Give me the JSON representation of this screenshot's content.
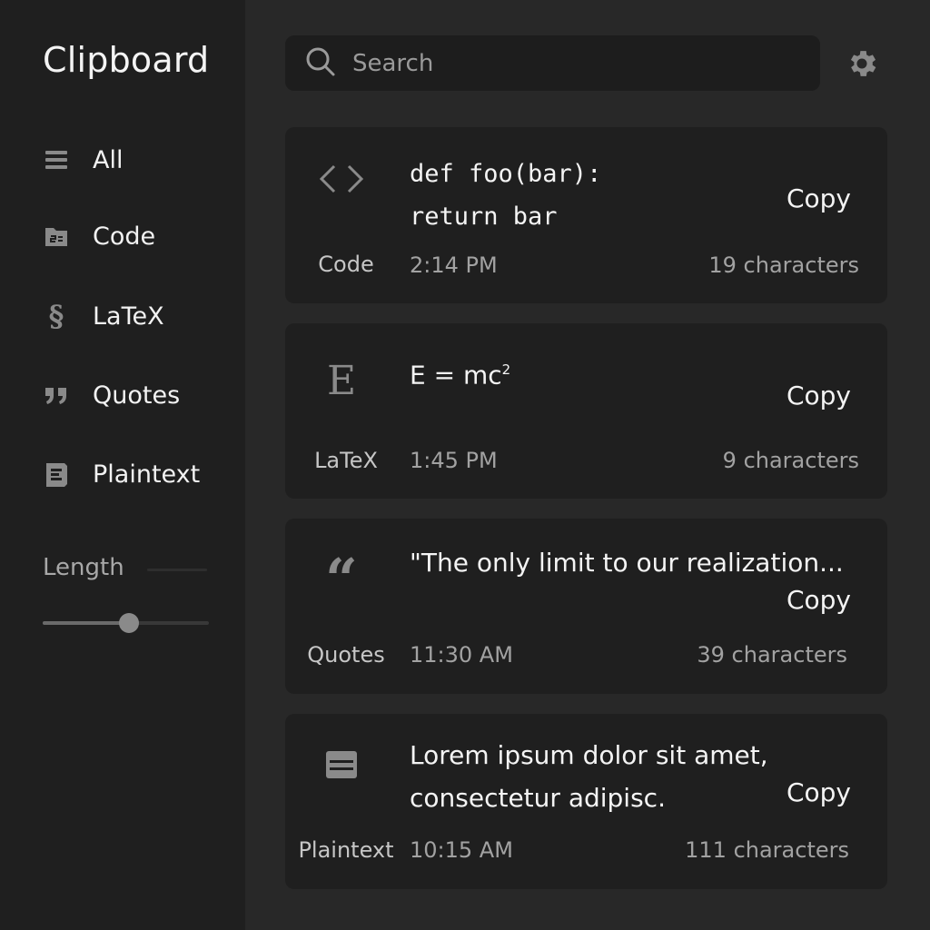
{
  "app": {
    "title": "Clipboard"
  },
  "sidebar": {
    "items": [
      {
        "label": "All",
        "icon": "list-icon"
      },
      {
        "label": "Code",
        "icon": "code-folder-icon"
      },
      {
        "label": "LaTeX",
        "icon": "section-icon"
      },
      {
        "label": "Quotes",
        "icon": "quote-icon"
      },
      {
        "label": "Plaintext",
        "icon": "text-icon"
      }
    ],
    "filter": {
      "label": "Length",
      "value_fraction": 0.52
    }
  },
  "search": {
    "placeholder": "Search",
    "value": ""
  },
  "clips": [
    {
      "type": "Code",
      "icon": "code-brackets-icon",
      "content_line1": "def foo(bar):",
      "content_line2": "return bar",
      "copy_label": "Copy",
      "time": "2:14 PM",
      "chars": "19 characters"
    },
    {
      "type": "LaTeX",
      "icon": "latex-e-icon",
      "content_base": "E = mc",
      "content_sup": "2",
      "copy_label": "Copy",
      "time": "1:45 PM",
      "chars": "9 characters"
    },
    {
      "type": "Quotes",
      "icon": "quote-icon",
      "content_line1": "\"The only limit to our realization...",
      "copy_label": "Copy",
      "time": "11:30 AM",
      "chars": "39 characters"
    },
    {
      "type": "Plaintext",
      "icon": "text-block-icon",
      "content_line1": "Lorem ipsum dolor sit amet,",
      "content_line2": "consectetur adipisc.",
      "copy_label": "Copy",
      "time": "10:15 AM",
      "chars": "111 characters"
    }
  ],
  "colors": {
    "background": "#282828",
    "sidebar": "#1f1f1f",
    "card": "#1f1f1f",
    "text": "#f2f2f2",
    "muted": "#a2a2a2",
    "icon": "#8a8a8a"
  }
}
